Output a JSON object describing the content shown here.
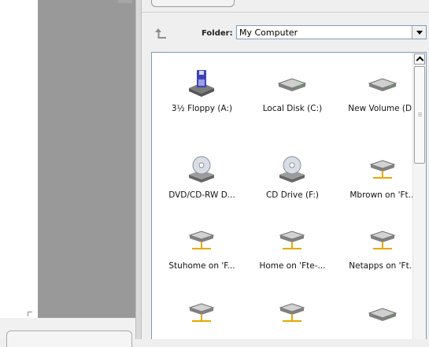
{
  "toolbar": {
    "folder_label": "Folder:",
    "folder_value": "My Computer"
  },
  "items": [
    {
      "label": "3½ Floppy (A:)",
      "icon": "floppy-drive-icon"
    },
    {
      "label": "Local Disk (C:)",
      "icon": "hard-disk-icon"
    },
    {
      "label": "New Volume (D:)",
      "icon": "hard-disk-icon"
    },
    {
      "label": "DVD/CD-RW D...",
      "icon": "cd-drive-icon"
    },
    {
      "label": "CD Drive (F:)",
      "icon": "cd-drive-icon"
    },
    {
      "label": "Mbrown on 'Ft...",
      "icon": "network-drive-icon"
    },
    {
      "label": "Stuhome on 'F...",
      "icon": "network-drive-icon"
    },
    {
      "label": "Home on 'Fte-...",
      "icon": "network-drive-icon"
    },
    {
      "label": "Netapps on 'Ft...",
      "icon": "network-drive-icon"
    },
    {
      "label": "",
      "icon": "network-drive-icon"
    },
    {
      "label": "",
      "icon": "network-drive-icon"
    },
    {
      "label": "",
      "icon": "hard-disk-icon"
    }
  ],
  "colors": {
    "panel_gray": "#999999",
    "list_border": "#7f9db9"
  }
}
